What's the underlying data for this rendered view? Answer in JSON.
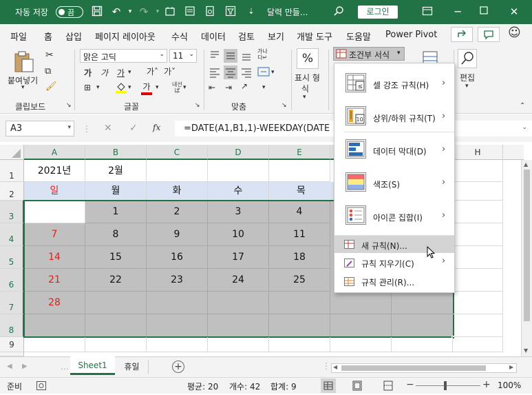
{
  "titlebar": {
    "autosave_label": "자동 저장",
    "autosave_state": "끔",
    "doc_title": "달력 만들...",
    "signin_label": "로그인"
  },
  "menu_tabs": [
    "파일",
    "홈",
    "삽입",
    "페이지 레이아웃",
    "수식",
    "데이터",
    "검토",
    "보기",
    "개발 도구",
    "도움말",
    "Power Pivot"
  ],
  "ribbon": {
    "paste_label": "붙여넣기",
    "clipboard_group": "클립보드",
    "font_name": "맑은 고딕",
    "font_size": "11",
    "font_group": "글꼴",
    "align_group": "맞춤",
    "number_format_label_1": "표시 형",
    "number_format_label_2": "식",
    "cond_format_label": "조건부 서식",
    "edit_label": "편집"
  },
  "formula_bar": {
    "name_box": "A3",
    "fx": "fx",
    "formula": "=DATE(A1,B1,1)-WEEKDAY(DATE"
  },
  "columns": [
    "A",
    "B",
    "C",
    "D",
    "E",
    "F",
    "G",
    "H"
  ],
  "rows": [
    "1",
    "2",
    "3",
    "4",
    "5",
    "6",
    "7",
    "8",
    "9"
  ],
  "cells": {
    "a1": "2021년",
    "b1": "2월",
    "weekdays": [
      "일",
      "월",
      "화",
      "수",
      "목"
    ],
    "row3": [
      "",
      "1",
      "2",
      "3",
      "4"
    ],
    "row4": [
      "7",
      "8",
      "9",
      "10",
      "11"
    ],
    "row5": [
      "14",
      "15",
      "16",
      "17",
      "18"
    ],
    "row6": [
      "21",
      "22",
      "23",
      "24",
      "25"
    ],
    "row7": [
      "28",
      "",
      "",
      "",
      ""
    ]
  },
  "cond_menu": {
    "items": [
      "셀 강조 규칙(H)",
      "상위/하위 규칙(T)",
      "데이터 막대(D)",
      "색조(S)",
      "아이콘 집합(I)"
    ],
    "small_items": [
      "새 규칙(N)...",
      "규칙 지우기(C)",
      "규칙 관리(R)..."
    ]
  },
  "sheet_tabs": [
    "Sheet1",
    "휴일"
  ],
  "status": {
    "ready": "준비",
    "average": "평균: 20",
    "count": "개수: 42",
    "sum": "합계: 9",
    "zoom": "100%"
  },
  "colors": {
    "accent": "#217346",
    "header_row": "#dae3f3",
    "selection": "#c0c0c0",
    "sunday": "#e0201b"
  }
}
